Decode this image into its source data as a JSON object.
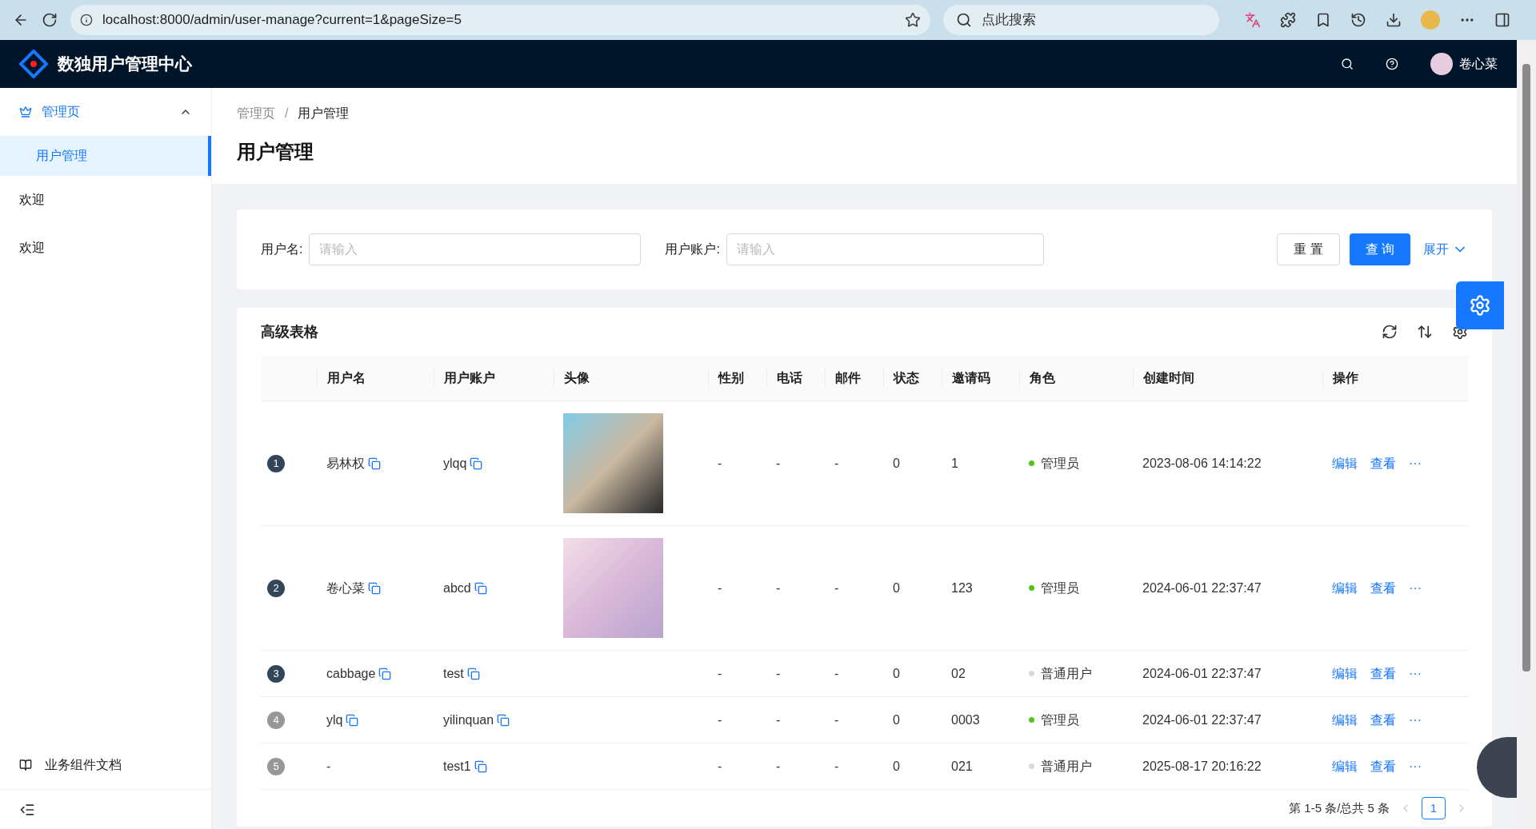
{
  "browser": {
    "url": "localhost:8000/admin/user-manage?current=1&pageSize=5",
    "search_placeholder": "点此搜索"
  },
  "header": {
    "title": "数独用户管理中心",
    "user": "卷心菜"
  },
  "sidebar": {
    "items": [
      {
        "label": "管理页",
        "kind": "group",
        "expanded": true,
        "children": [
          {
            "label": "用户管理",
            "selected": true
          }
        ]
      },
      {
        "label": "欢迎",
        "kind": "item",
        "selected": false
      },
      {
        "label": "欢迎",
        "kind": "item",
        "selected": false
      }
    ],
    "footer_link": "业务组件文档"
  },
  "breadcrumb": {
    "items": [
      "管理页",
      "用户管理"
    ],
    "separator": "/"
  },
  "page_title": "用户管理",
  "search": {
    "fields": [
      {
        "label": "用户名:",
        "placeholder": "请输入"
      },
      {
        "label": "用户账户:",
        "placeholder": "请输入"
      }
    ],
    "reset": "重 置",
    "query": "查 询",
    "expand": "展开"
  },
  "table": {
    "title": "高级表格",
    "columns": [
      "用户名",
      "用户账户",
      "头像",
      "性别",
      "电话",
      "邮件",
      "状态",
      "邀请码",
      "角色",
      "创建时间",
      "操作"
    ],
    "rows": [
      {
        "index": "1",
        "top": true,
        "username": "易林权",
        "account": "ylqq",
        "avatar": {
          "kind": "cartoon"
        },
        "gender": "-",
        "phone": "-",
        "email": "-",
        "status": "0",
        "code": "1",
        "role": "管理员",
        "color": "#52c41a",
        "created": "2023-08-06 14:14:22",
        "actions": [
          "编辑",
          "查看",
          "···"
        ]
      },
      {
        "index": "2",
        "top": true,
        "username": "卷心菜",
        "account": "abcd",
        "avatar": {
          "kind": "illustration"
        },
        "gender": "-",
        "phone": "-",
        "email": "-",
        "status": "0",
        "code": "123",
        "role": "管理员",
        "color": "#52c41a",
        "created": "2024-06-01 22:37:47",
        "actions": [
          "编辑",
          "查看",
          "···"
        ]
      },
      {
        "index": "3",
        "top": true,
        "username": "cabbage",
        "account": "test",
        "gender": "-",
        "phone": "-",
        "email": "-",
        "status": "0",
        "code": "02",
        "role": "普通用户",
        "color": "#d9d9d9",
        "created": "2024-06-01 22:37:47",
        "actions": [
          "编辑",
          "查看",
          "···"
        ]
      },
      {
        "index": "4",
        "top": false,
        "username": "ylq",
        "account": "yilinquan",
        "gender": "-",
        "phone": "-",
        "email": "-",
        "status": "0",
        "code": "0003",
        "role": "管理员",
        "color": "#52c41a",
        "created": "2024-06-01 22:37:47",
        "actions": [
          "编辑",
          "查看",
          "···"
        ]
      },
      {
        "index": "5",
        "top": false,
        "username": "-",
        "username_copyable": false,
        "account": "test1",
        "gender": "-",
        "phone": "-",
        "email": "-",
        "status": "0",
        "code": "021",
        "role": "普通用户",
        "color": "#d9d9d9",
        "created": "2025-08-17 20:16:22",
        "actions": [
          "编辑",
          "查看",
          "···"
        ]
      }
    ]
  },
  "pagination": {
    "summary": "第 1-5 条/总共 5 条",
    "pages": [
      {
        "label": "1",
        "selected": true
      }
    ]
  }
}
